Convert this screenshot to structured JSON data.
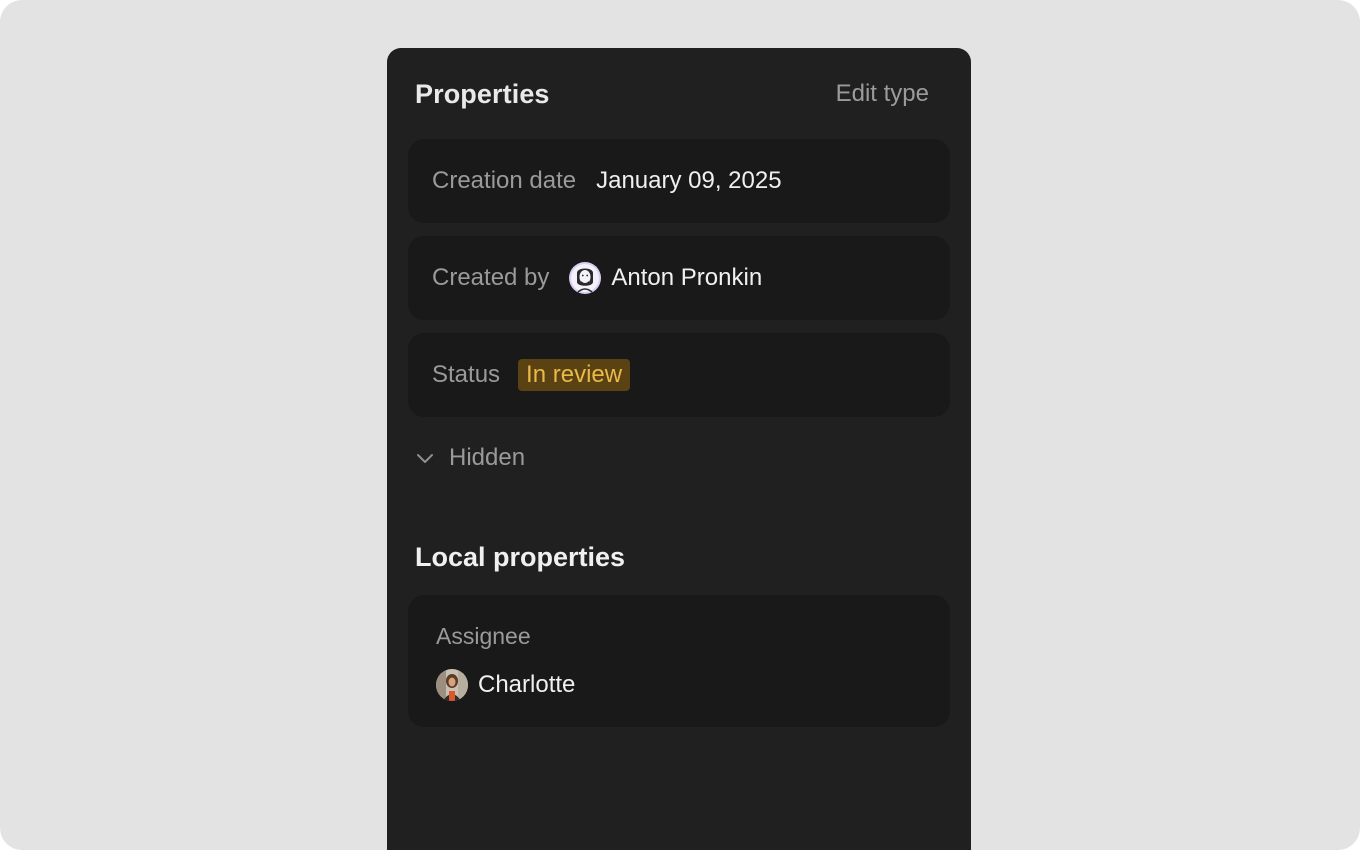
{
  "panel": {
    "title": "Properties",
    "edit_type_label": "Edit type"
  },
  "properties": [
    {
      "label": "Creation date",
      "value": "January 09, 2025"
    },
    {
      "label": "Created by",
      "value": "Anton Pronkin",
      "icon": "user-avatar-icon"
    },
    {
      "label": "Status",
      "value": "In review",
      "badge_bg": "#5a4212",
      "badge_fg": "#e9b949"
    }
  ],
  "hidden_section": {
    "label": "Hidden",
    "icon": "chevron-down-icon"
  },
  "local_properties": {
    "title": "Local properties",
    "assignee": {
      "label": "Assignee",
      "value": "Charlotte",
      "icon": "user-avatar-icon"
    }
  },
  "colors": {
    "page_bg": "#e3e3e3",
    "panel_bg": "#202020",
    "card_bg": "#191919"
  }
}
